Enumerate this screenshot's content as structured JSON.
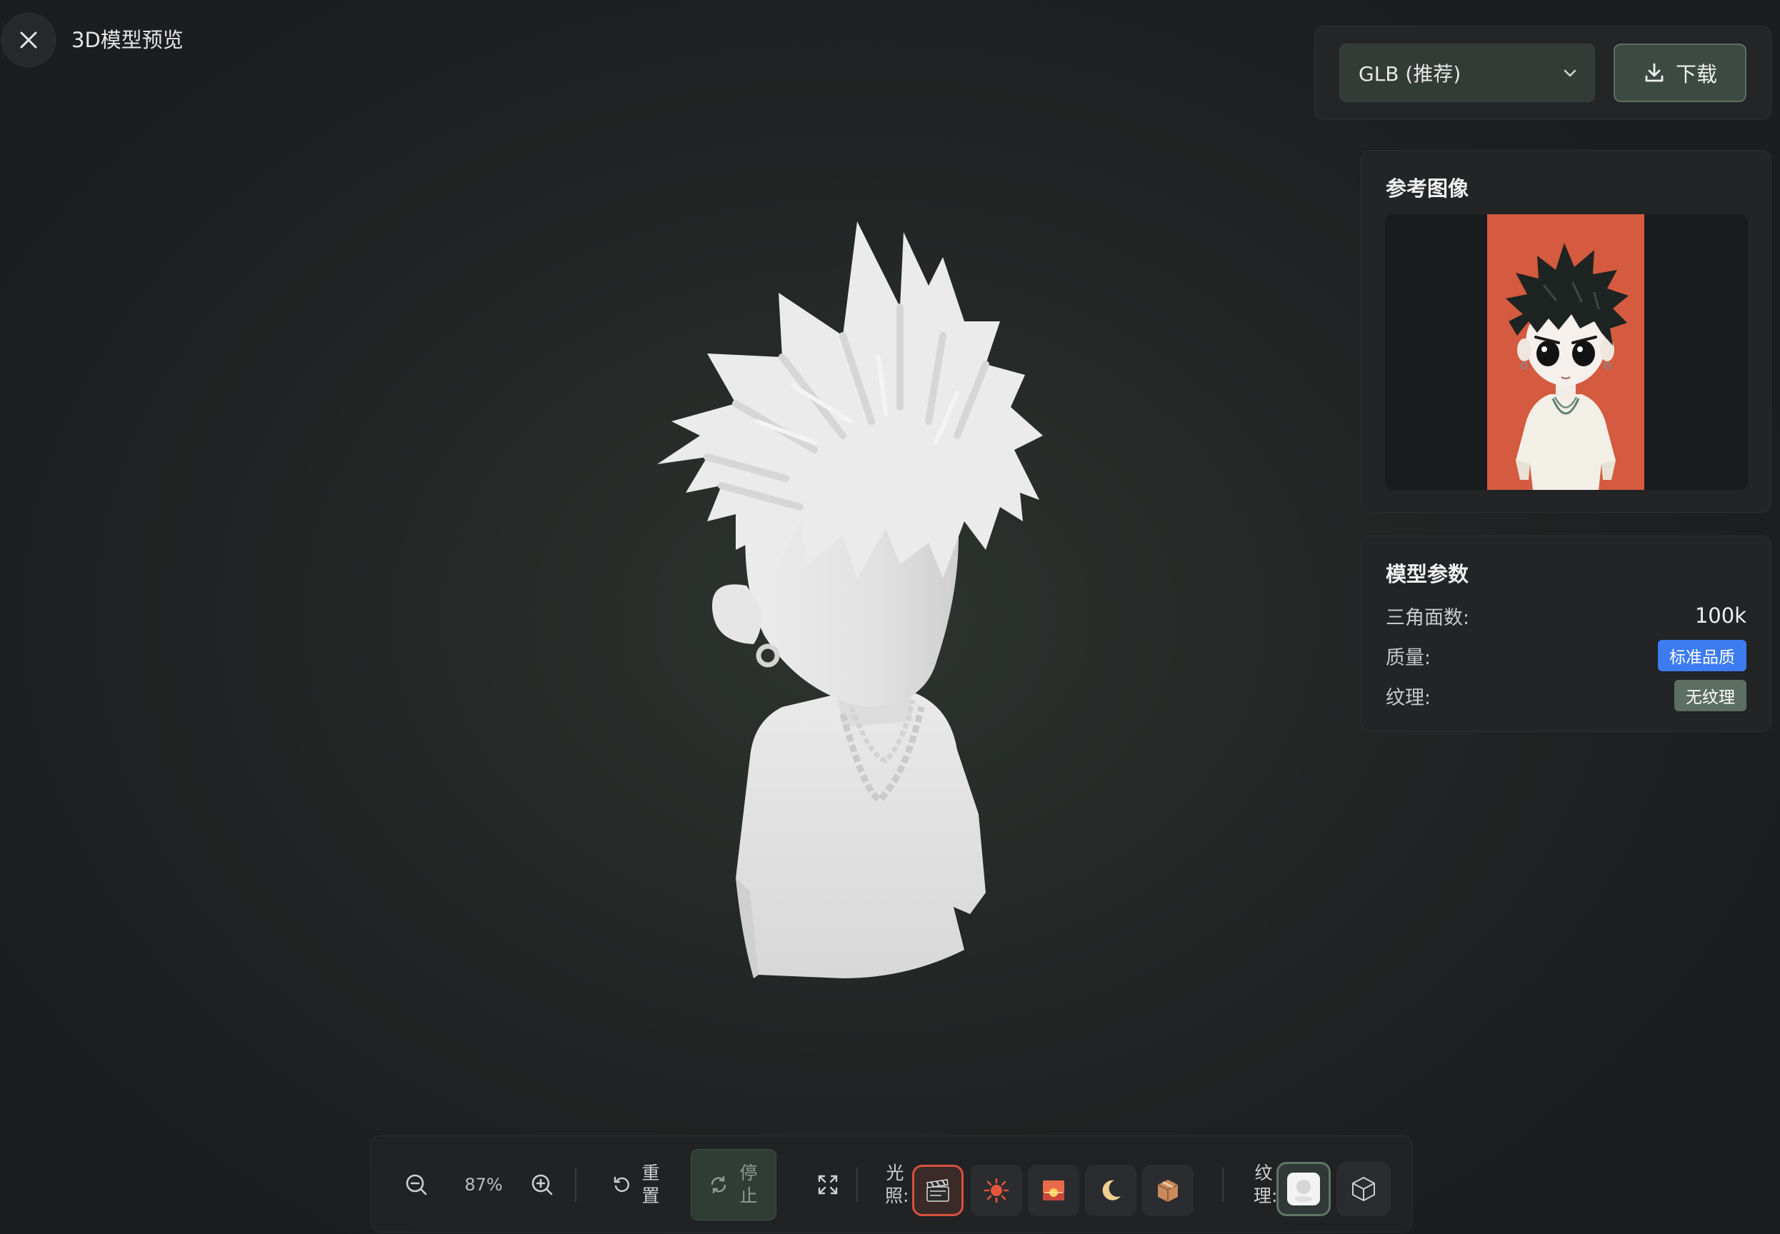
{
  "header": {
    "title": "3D模型预览",
    "close_icon": "close-icon"
  },
  "download": {
    "format_selected": "GLB (推荐)",
    "download_label": "下载"
  },
  "reference": {
    "title": "参考图像"
  },
  "params": {
    "title": "模型参数",
    "rows": [
      {
        "label": "三角面数:",
        "value": "100k"
      },
      {
        "label": "质量:",
        "value": "标准品质"
      },
      {
        "label": "纹理:",
        "value": "无纹理"
      }
    ]
  },
  "toolbar": {
    "zoom_level": "87%",
    "reset_label": "重置",
    "stop_label": "停止",
    "lighting_label": "光照:",
    "texture_label": "纹理:",
    "lighting_options": [
      "clapperboard-icon",
      "sun-icon",
      "sunset-icon",
      "moon-icon",
      "box-icon"
    ],
    "texture_options": [
      "sphere-icon",
      "cube-wireframe-icon"
    ]
  },
  "colors": {
    "accent_green": "#3c4a42",
    "quality_badge": "#3c7bf0",
    "texture_badge": "#5d6e63",
    "active_light_border": "#d9503c",
    "reference_background": "#d45a40"
  }
}
